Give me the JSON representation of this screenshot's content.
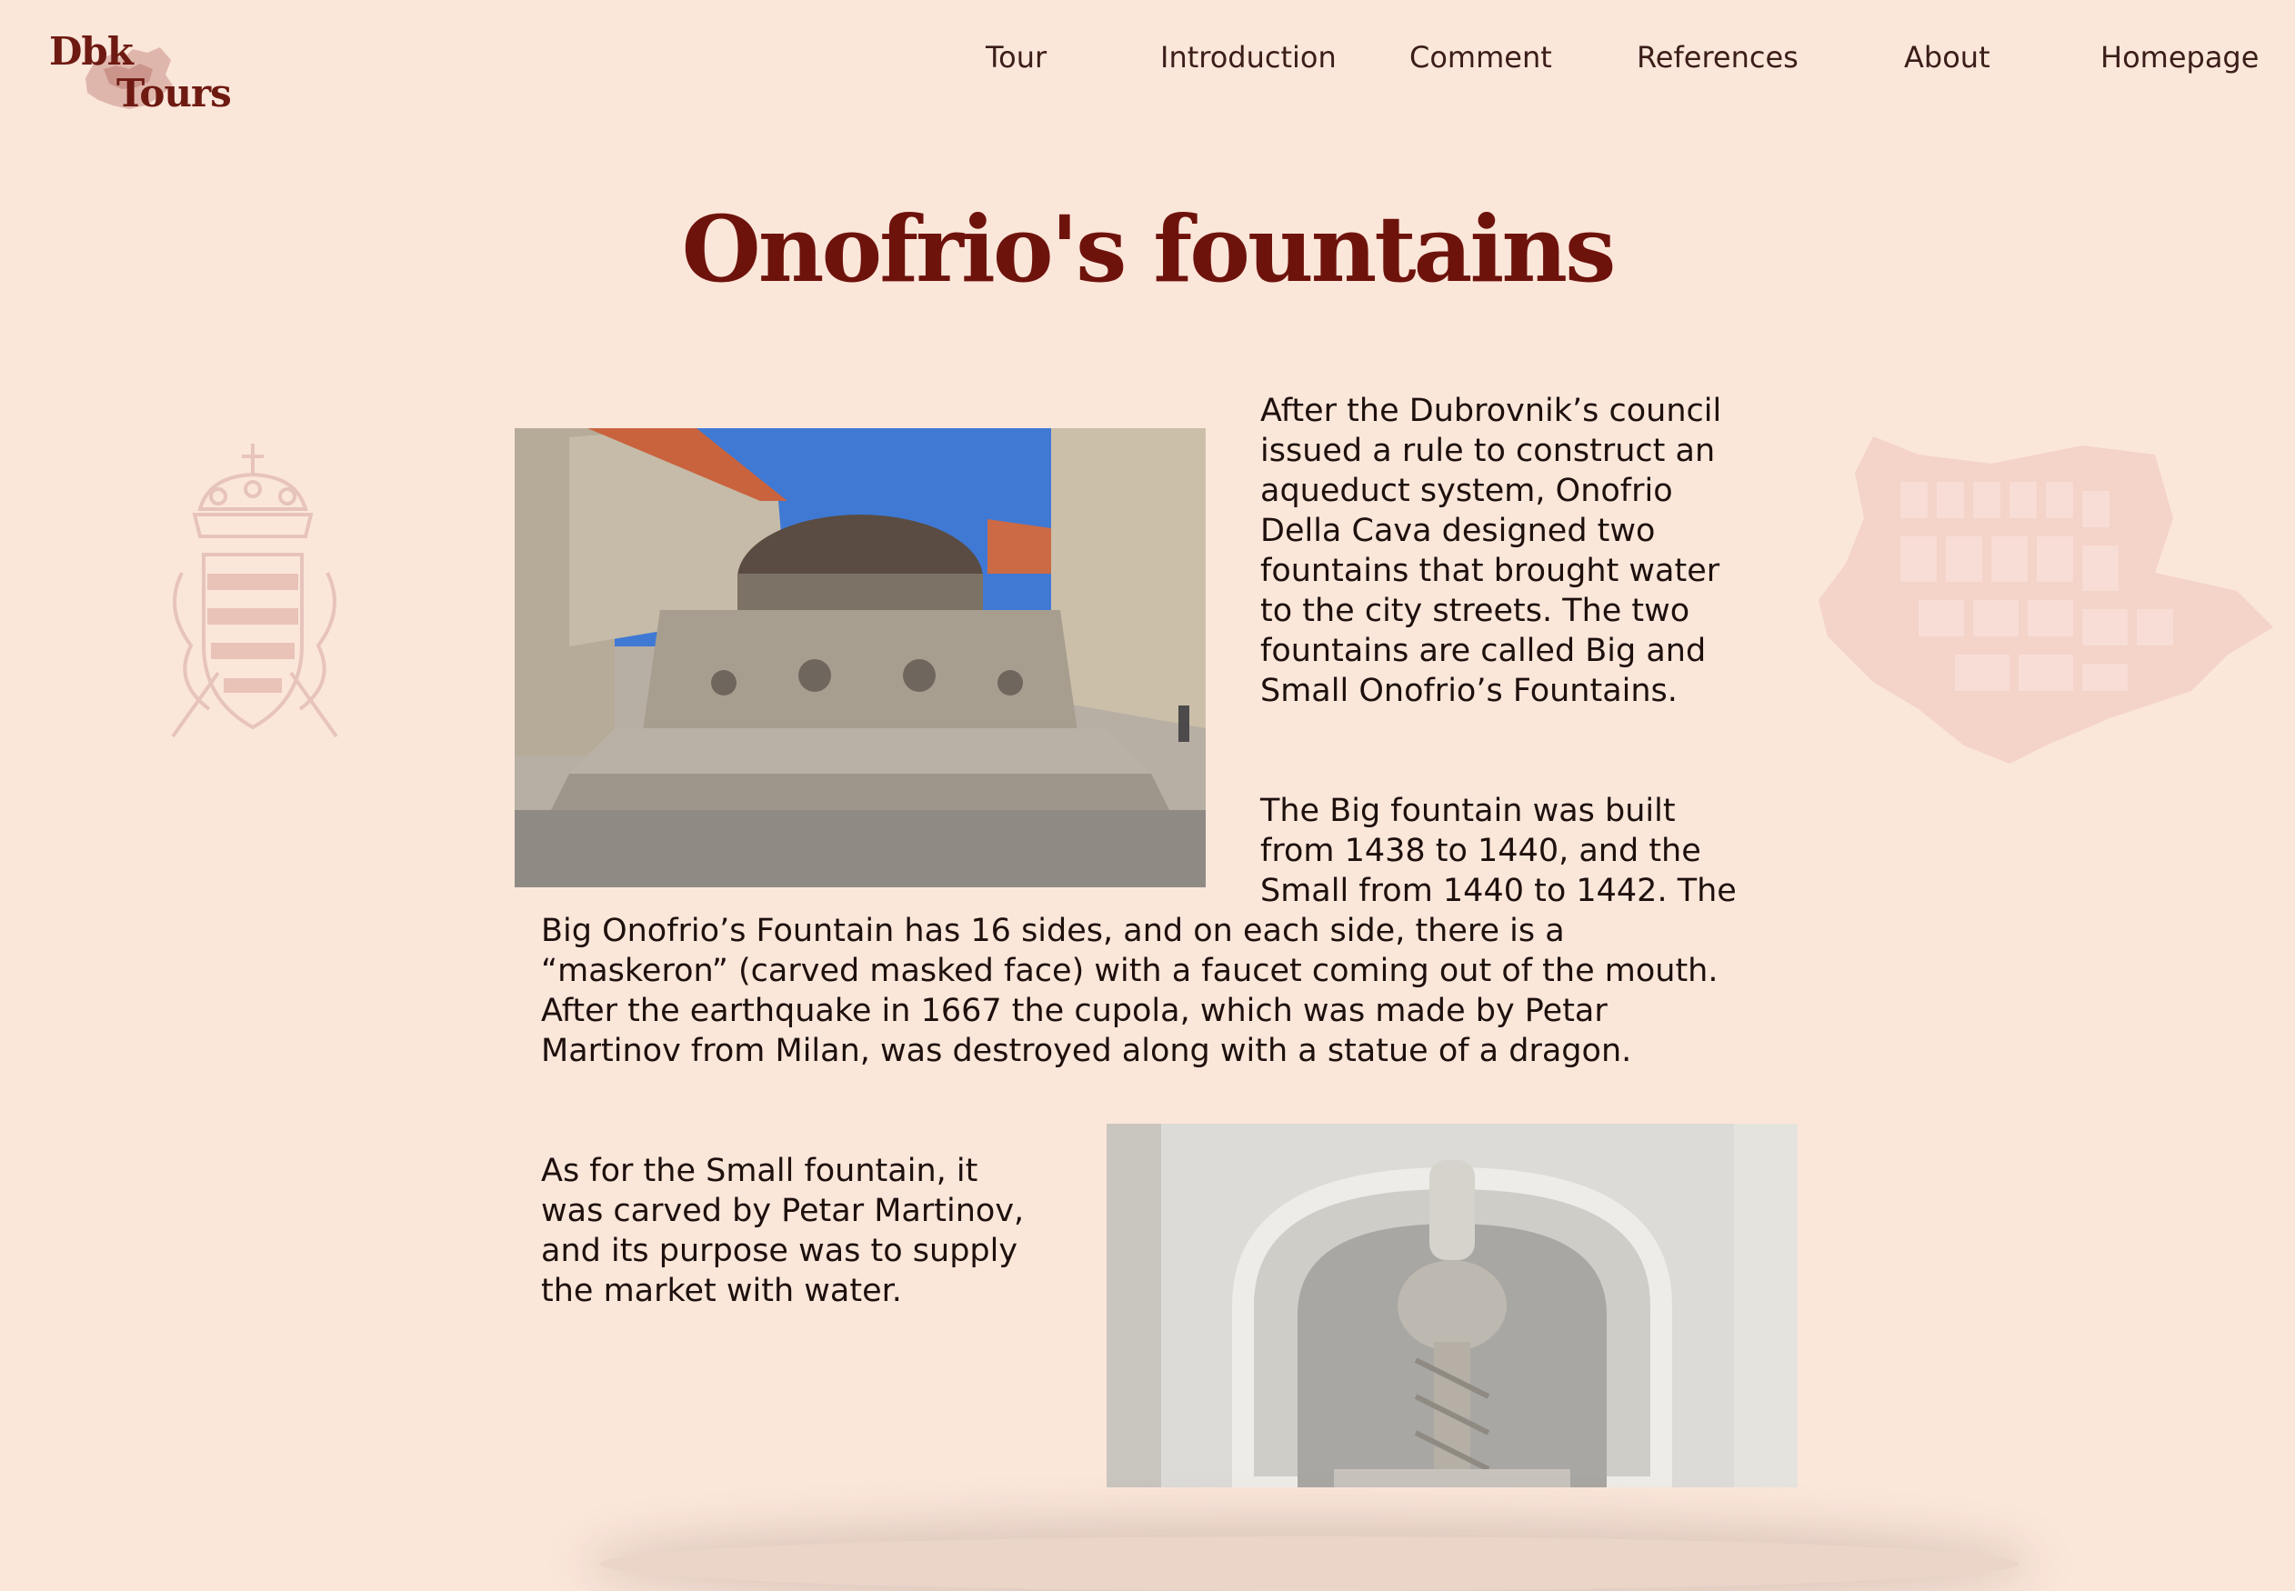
{
  "logo": {
    "line1": "Dbk",
    "line2": "Tours",
    "text_color": "#6e1a12",
    "map_color": "#c98e86"
  },
  "nav": {
    "items": [
      {
        "label": "Tour"
      },
      {
        "label": "Introduction"
      },
      {
        "label": "Comment"
      },
      {
        "label": "References"
      },
      {
        "label": "About"
      },
      {
        "label": "Homepage"
      }
    ]
  },
  "page": {
    "title": "Onofrio's fountains",
    "background": "#fbe6da",
    "title_color": "#6e130c"
  },
  "decor": {
    "crest_icon": "dubrovnik-coat-of-arms",
    "map_icon": "dubrovnik-old-town-map"
  },
  "content": {
    "paragraphs": [
      "After the Dubrovnik’s council issued a rule to construct an aqueduct system, Onofrio Della Cava designed two fountains that brought water to the city streets. The two fountains are called Big and Small Onofrio’s Fountains.",
      "The Big fountain was built from 1438 to 1440, and the Small from 1440 to 1442. The Big Onofrio’s Fountain has 16 sides, and on each side, there is a “maskeron” (carved masked face) with a faucet coming out of the mouth. After the earthquake in 1667 the cupola, which was made by Petar Martinov from Milan, was destroyed along with a statue of a dragon.",
      "As for the Small fountain, it was carved by Petar Martinov, and its purpose was to supply the market with water."
    ]
  }
}
